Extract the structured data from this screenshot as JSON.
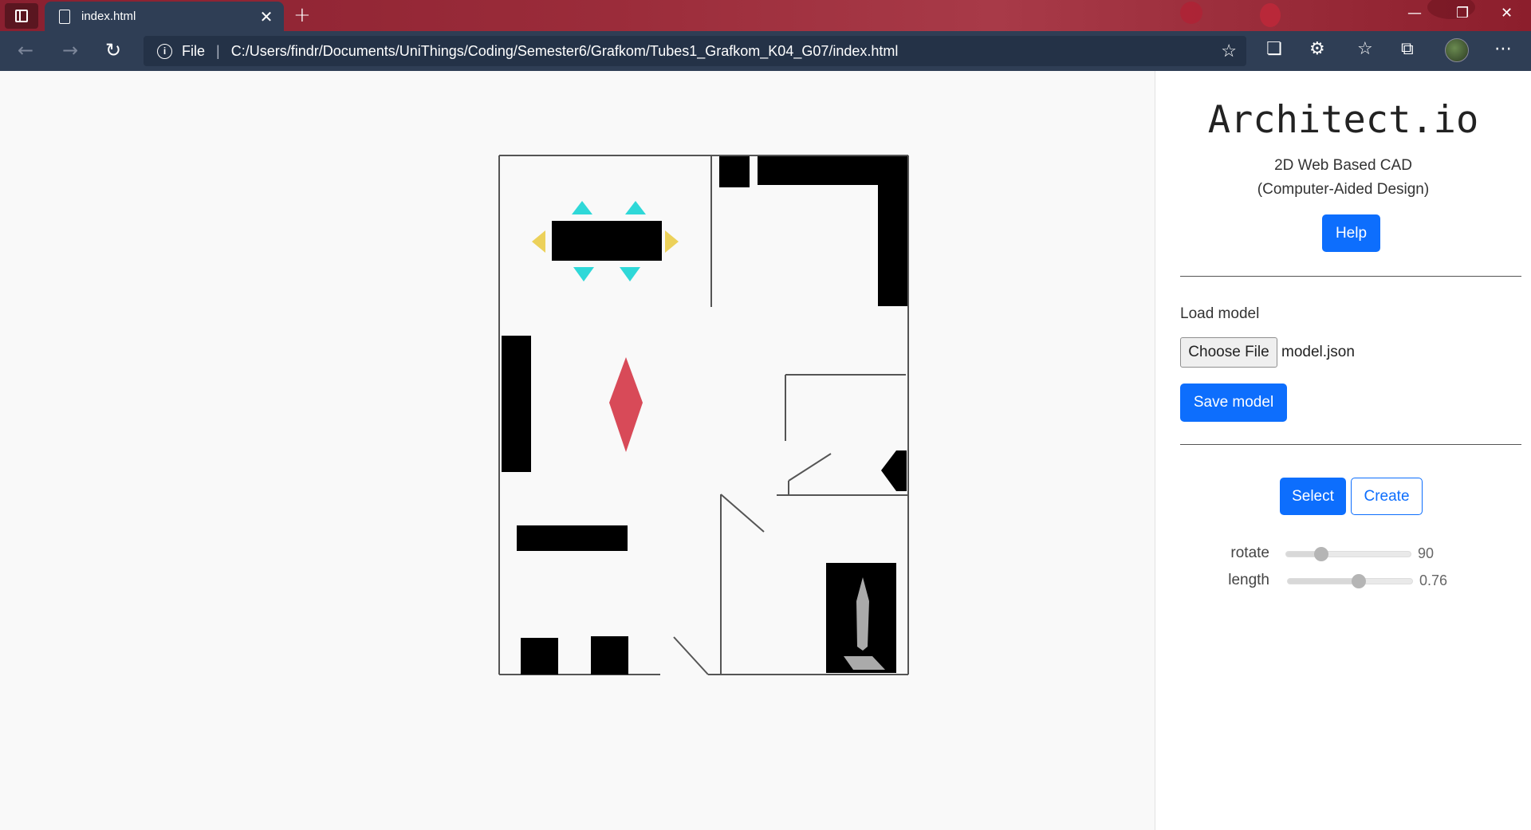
{
  "browser": {
    "tab_title": "index.html",
    "tab_close": "✕",
    "new_tab": "+",
    "url_scheme": "File",
    "url_separator": "|",
    "url": "C:/Users/findr/Documents/UniThings/Coding/Semester6/Grafkom/Tubes1_Grafkom_K04_G07/index.html",
    "icons": [
      "tab-actions-icon",
      "document-icon",
      "back-icon",
      "forward-icon",
      "refresh-icon",
      "info-icon",
      "add-favorite-icon",
      "extension-icon",
      "extensions-icon",
      "favorites-icon",
      "collections-icon",
      "profile-avatar",
      "more-icon",
      "minimize-icon",
      "restore-icon",
      "window-close-icon"
    ]
  },
  "panel": {
    "brand": "Architect.io",
    "subtitle_line1": "2D Web Based CAD",
    "subtitle_line2": "(Computer-Aided Design)",
    "help_label": "Help",
    "load_label": "Load model",
    "choose_file_label": "Choose File",
    "file_name": "model.json",
    "save_label": "Save model",
    "mode_select_label": "Select",
    "mode_create_label": "Create",
    "active_mode": "Select",
    "sliders": [
      {
        "label": "rotate",
        "value": "90",
        "fraction": 0.28
      },
      {
        "label": "length",
        "value": "0.76",
        "fraction": 0.57
      }
    ]
  },
  "colors": {
    "accent": "#0d6efd",
    "chrome": "#2f3e55",
    "plan_red": "#d84a58",
    "plan_cyan": "#2fd8d8",
    "plan_yellow": "#ecd15a",
    "plan_black": "#000000",
    "plan_line": "#555555"
  }
}
